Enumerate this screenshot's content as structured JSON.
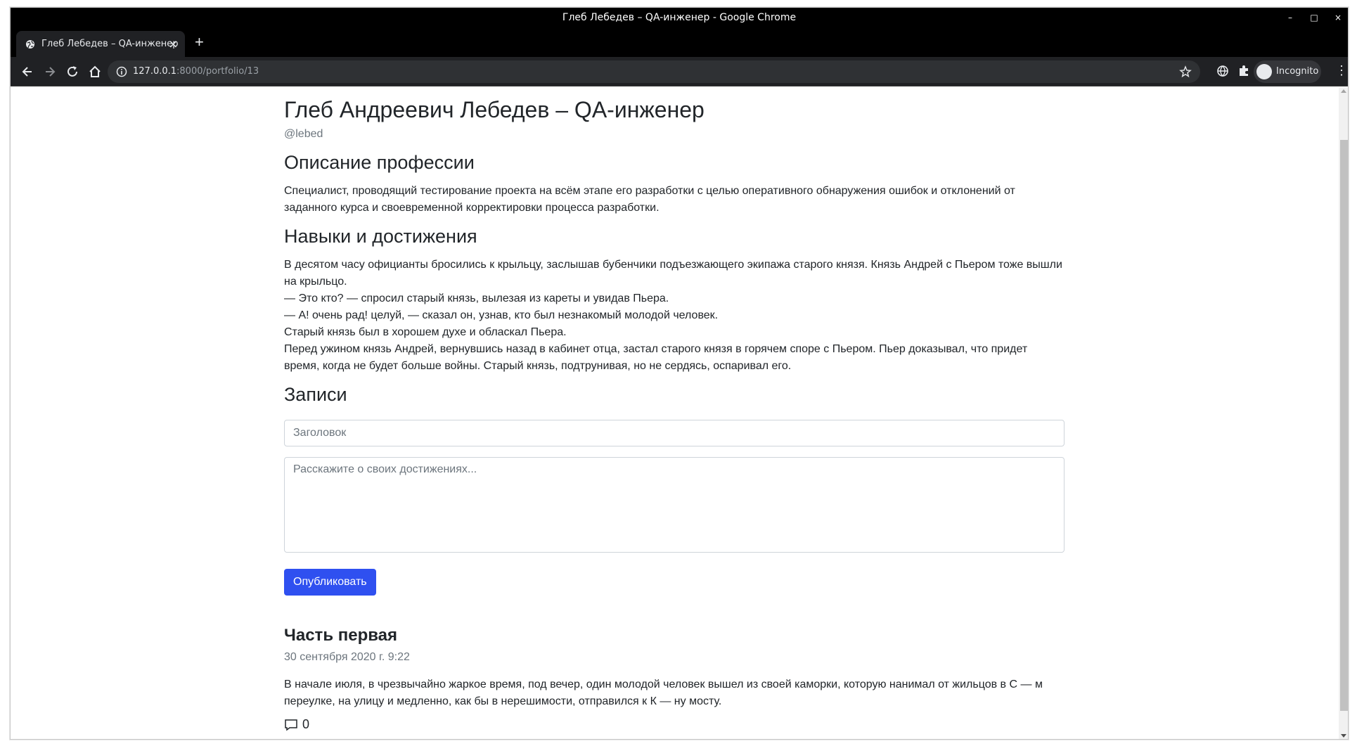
{
  "window": {
    "title": "Глеб Лебедев – QA-инженер - Google Chrome",
    "minimize": "–",
    "maximize": "□",
    "close": "×"
  },
  "tab": {
    "title": "Глеб Лебедев – QA-инженер",
    "close": "×",
    "new_tab": "+"
  },
  "omnibox": {
    "host": "127.0.0.1",
    "rest": ":8000/portfolio/13"
  },
  "profile": {
    "label": "Incognito"
  },
  "menu": "⋮",
  "page": {
    "title": "Глеб Андреевич Лебедев – QA-инженер",
    "username": "@lebed",
    "profession_heading": "Описание профессии",
    "profession_lines": [
      "Специалист, проводящий тестирование проекта на всём этапе его разработки с целью оперативного обнаружения ошибок и отклонений от",
      "заданного курса и своевременной корректировки процесса разработки."
    ],
    "skills_heading": "Навыки и достижения",
    "skills_lines": [
      "В десятом часу официанты бросились к крыльцу, заслышав бубенчики подъезжающего экипажа старого князя. Князь Андрей с Пьером тоже вышли",
      "на крыльцо.",
      "— Это кто? — спросил старый князь, вылезая из кареты и увидав Пьера.",
      "— А! очень рад! целуй, — сказал он, узнав, кто был незнакомый молодой человек.",
      "Старый князь был в хорошем духе и обласкал Пьера.",
      "Перед ужином князь Андрей, вернувшись назад в кабинет отца, застал старого князя в горячем споре с Пьером. Пьер доказывал, что придет",
      "время, когда не будет больше войны. Старый князь, подтрунивая, но не сердясь, оспаривал его."
    ],
    "posts_heading": "Записи",
    "title_placeholder": "Заголовок",
    "body_placeholder": "Расскажите о своих достижениях...",
    "publish_label": "Опубликовать"
  },
  "post": {
    "title": "Часть первая",
    "date": "30 сентября 2020 г. 9:22",
    "body_lines": [
      "В начале июля, в чрезвычайно жаркое время, под вечер, один молодой человек вышел из своей каморки, которую нанимал от жильцов в С — м",
      "переулке, на улицу и медленно, как бы в нерешимости, отправился к К — ну мосту."
    ],
    "comment_count": "0"
  },
  "colors": {
    "primary_button": "#2f50f0",
    "muted_text": "#6c757d",
    "body_text": "#212529"
  }
}
